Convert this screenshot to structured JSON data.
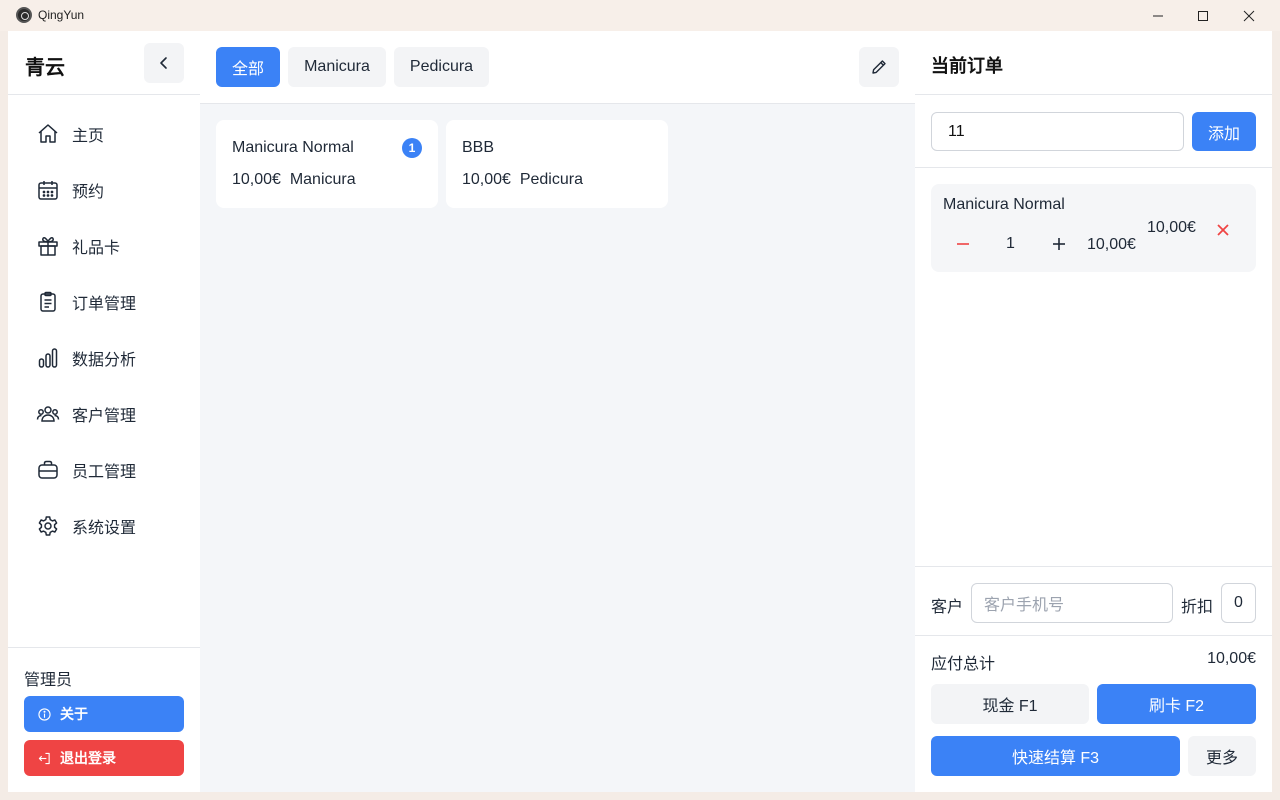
{
  "window": {
    "title": "QingYun"
  },
  "sidebar": {
    "brand": "青云",
    "items": [
      {
        "label": "主页",
        "icon": "home-icon"
      },
      {
        "label": "预约",
        "icon": "calendar-icon"
      },
      {
        "label": "礼品卡",
        "icon": "gift-icon"
      },
      {
        "label": "订单管理",
        "icon": "clipboard-icon"
      },
      {
        "label": "数据分析",
        "icon": "bar-chart-icon"
      },
      {
        "label": "客户管理",
        "icon": "users-icon"
      },
      {
        "label": "员工管理",
        "icon": "briefcase-icon"
      },
      {
        "label": "系统设置",
        "icon": "gear-icon"
      }
    ],
    "role": "管理员",
    "about_label": "关于",
    "logout_label": "退出登录"
  },
  "main": {
    "tabs": [
      {
        "label": "全部",
        "active": true
      },
      {
        "label": "Manicura",
        "active": false
      },
      {
        "label": "Pedicura",
        "active": false
      }
    ],
    "products": [
      {
        "name": "Manicura Normal",
        "price": "10,00€",
        "category": "Manicura",
        "badge": "1"
      },
      {
        "name": "BBB",
        "price": "10,00€",
        "category": "Pedicura",
        "badge": ""
      }
    ]
  },
  "order": {
    "title": "当前订单",
    "code_value": "11",
    "add_label": "添加",
    "items": [
      {
        "name": "Manicura Normal",
        "qty": "1",
        "unit_price": "10,00€",
        "line_total": "10,00€"
      }
    ],
    "customer_label": "客户",
    "customer_placeholder": "客户手机号",
    "discount_label": "折扣",
    "discount_value": "0",
    "total_label": "应付总计",
    "total_value": "10,00€",
    "cash_label": "现金  F1",
    "card_label": "刷卡  F2",
    "quick_label": "快速结算  F3",
    "more_label": "更多"
  },
  "colors": {
    "accent": "#3b82f6",
    "danger": "#ef4444"
  }
}
